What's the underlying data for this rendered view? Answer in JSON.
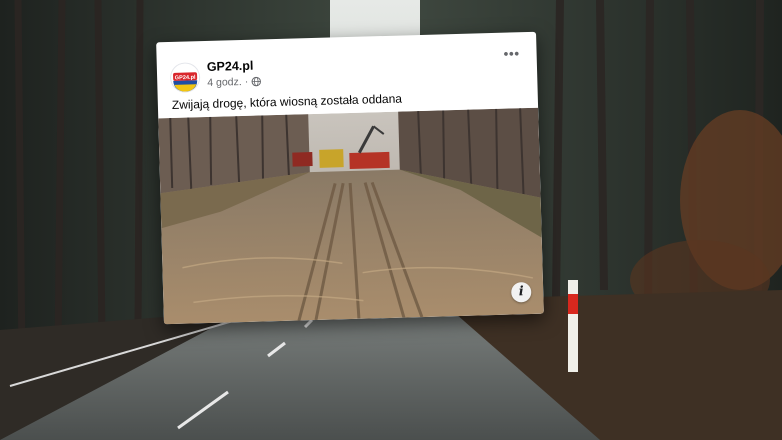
{
  "post": {
    "page_name": "GP24.pl",
    "avatar_logo_text": "GP24.pl",
    "time_ago": "4 godz.",
    "meta_separator": "·",
    "audience_icon": "globe-icon",
    "more_icon": "more-options-icon",
    "more_glyph": "•••",
    "text": "Zwijają drogę, która wiosną została oddana",
    "info_icon": "info-icon",
    "info_glyph": "i"
  },
  "colors": {
    "card_background": "#ffffff",
    "page_name": "#050505",
    "meta_text": "#65676b",
    "logo_red": "#d9262c",
    "logo_blue": "#1f4fa3",
    "logo_yellow": "#f2c511"
  }
}
